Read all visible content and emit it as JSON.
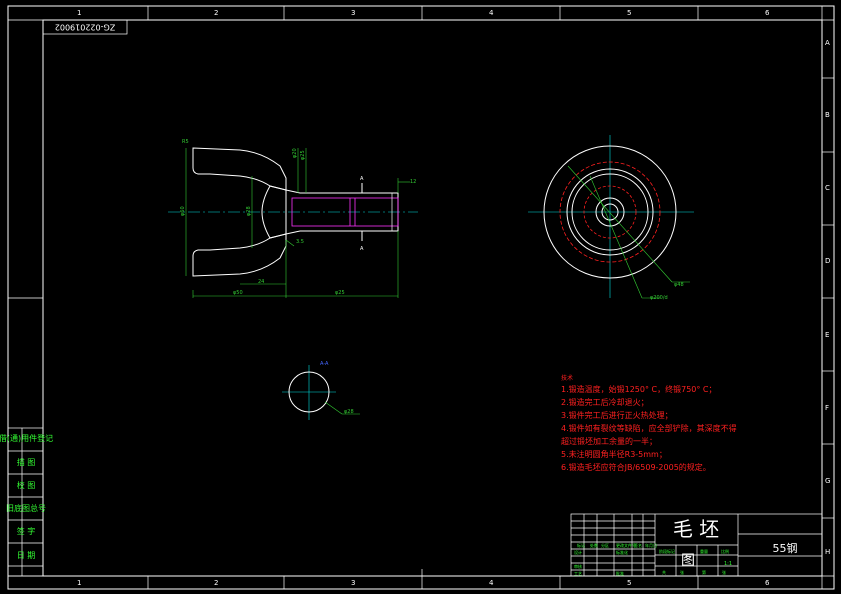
{
  "drawing_number": "ZG-022019002",
  "zone_numbers": [
    "1",
    "2",
    "3",
    "4",
    "5",
    "6"
  ],
  "zone_letters": [
    "A",
    "B",
    "C",
    "D",
    "E",
    "F",
    "G",
    "H"
  ],
  "sidebar_labels": [
    "借(通)用件登记",
    "描 图",
    "校 图",
    "旧底图总号",
    "签 字",
    "日 期"
  ],
  "notes": {
    "title": "技术",
    "lines": [
      "1.锻造温度，始锻1250° C，终锻750° C；",
      "2.锻造完工后冷却退火；",
      "3.锻件完工后进行正火热处理；",
      "4.锻件如有裂纹等缺陷，应全部铲除，其深度不得",
      "超过锻坯加工余量的一半；",
      "5.未注明圆角半径R3-5mm；",
      "6.锻造毛坯应符合JB/6509-2005的规定。"
    ]
  },
  "title_block": {
    "part_name": "毛 坯",
    "part_name_2": "图",
    "material": "55钢",
    "scale": "1:1",
    "small_labels": [
      "标记",
      "处数",
      "分区",
      "更改文件号",
      "签名",
      "年月日",
      "设计",
      "标准化",
      "阶段标记",
      "重量",
      "比例",
      "审核",
      "工艺",
      "批准",
      "共",
      "张",
      "第",
      "张"
    ]
  },
  "annotations": {
    "section_label": "A-A",
    "section_a_top": "A",
    "section_a_bottom": "A",
    "dim_left_1": "R5",
    "dim_bottom_1": "φ50",
    "dim_bottom_2": "24",
    "dim_bottom_3": "φ25",
    "dim_right_top": "12",
    "dim_hole": "3.5",
    "dim_top_1": "φ20",
    "dim_top_2": "φ25",
    "dim_vert_left": "φ60",
    "dim_vert_mid": "φ28",
    "dim_circle_1": "φ48",
    "dim_circle_2": "φ200/d",
    "dim_section": "φ28"
  },
  "colors": {
    "background": "#000000",
    "frame": "#ffffff",
    "dimension": "#33cc33",
    "centerline": "#00e0e0",
    "notes": "#ff2020",
    "hidden": "#ff33ff",
    "sidebar_text": "#33ff33"
  }
}
